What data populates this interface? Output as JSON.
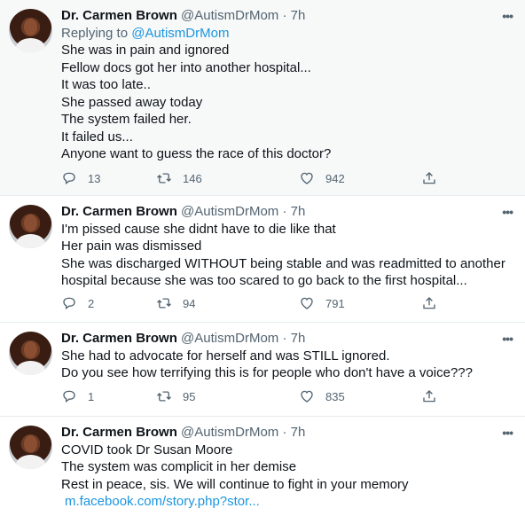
{
  "tweets": [
    {
      "author": "Dr. Carmen Brown",
      "handle": "@AutismDrMom",
      "time": "· 7h",
      "replying_prefix": "Replying to",
      "replying_to": "@AutismDrMom",
      "lines": [
        "She was in pain and ignored",
        "Fellow docs got her into another hospital...",
        "It was too late..",
        "She passed away today",
        "The system failed her.",
        "It failed us...",
        "Anyone want to guess the race of this doctor?"
      ],
      "replies": "13",
      "retweets": "146",
      "likes": "942"
    },
    {
      "author": "Dr. Carmen Brown",
      "handle": "@AutismDrMom",
      "time": "· 7h",
      "lines": [
        "I'm pissed cause she didnt have to die like that",
        "Her pain was dismissed",
        "She was discharged WITHOUT being stable and was readmitted to another",
        "hospital because she was too scared to go back to the first hospital..."
      ],
      "replies": "2",
      "retweets": "94",
      "likes": "791"
    },
    {
      "author": "Dr. Carmen Brown",
      "handle": "@AutismDrMom",
      "time": "· 7h",
      "lines": [
        "She had to advocate for herself and was STILL ignored.",
        "Do you see how terrifying this is for people who don't have a voice???"
      ],
      "replies": "1",
      "retweets": "95",
      "likes": "835"
    },
    {
      "author": "Dr. Carmen Brown",
      "handle": "@AutismDrMom",
      "time": "· 7h",
      "lines": [
        "COVID took Dr Susan Moore",
        "The system was complicit in her demise",
        "Rest in peace, sis. We will continue to fight in your memory"
      ],
      "link": "m.facebook.com/story.php?stor..."
    }
  ],
  "colors": {
    "accent": "#1b95e0",
    "muted": "#536471",
    "highlight_bg": "#f7f9f9"
  }
}
